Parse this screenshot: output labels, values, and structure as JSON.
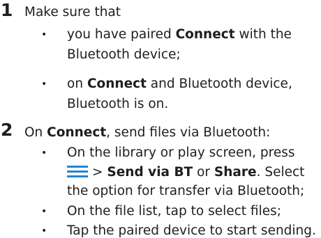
{
  "step1": {
    "number": "1",
    "intro": "Make sure that",
    "bullet_char": "•",
    "bullet1": {
      "part1": "you have paired ",
      "connect": "Connect",
      "part2": " with the",
      "line2": "Bluetooth device;"
    },
    "bullet2": {
      "part1": "on ",
      "connect": "Connect",
      "part2": " and Bluetooth device,",
      "line2": "Bluetooth is on."
    }
  },
  "step2": {
    "number": "2",
    "intro_part1": "On ",
    "connect": "Connect",
    "intro_part2": ", send files via Bluetooth:",
    "bullet_char": "•",
    "bullet1": {
      "line1": "On the library or play screen, press",
      "icon": "menu-icon",
      "gt": ">",
      "send_via_bt": "Send via BT",
      "or": "or",
      "share": "Share",
      "select": ". Select",
      "line3": "the option for transfer via Bluetooth;"
    },
    "bullet2": "On the file list, tap to select files;",
    "bullet3": "Tap the paired device to start sending."
  },
  "colors": {
    "text": "#1e1e1e",
    "menu_icon": "#1f86d3"
  }
}
